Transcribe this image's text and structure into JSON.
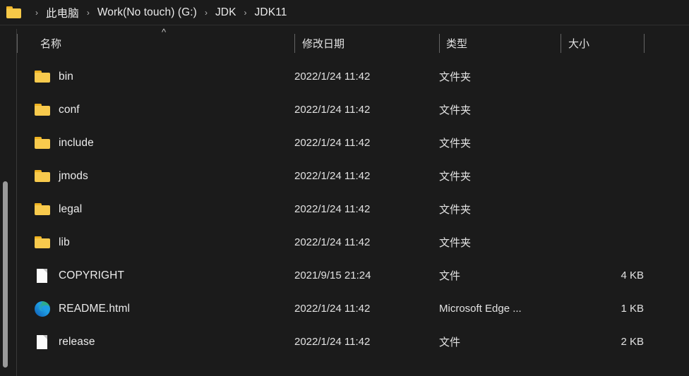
{
  "window": {
    "background_color": "#1b1b1b",
    "text_color": "#e6e6e6"
  },
  "breadcrumb": {
    "leading_icon": "folder-icon",
    "separator": "›",
    "crumbs": [
      {
        "label": "此电脑"
      },
      {
        "label": "Work(No touch) (G:)"
      },
      {
        "label": "JDK"
      },
      {
        "label": "JDK11"
      }
    ]
  },
  "columns": {
    "sort_indicator_icon": "chevron-up-icon",
    "items": [
      {
        "key": "name",
        "label": "名称"
      },
      {
        "key": "date",
        "label": "修改日期"
      },
      {
        "key": "type",
        "label": "类型"
      },
      {
        "key": "size",
        "label": "大小"
      }
    ]
  },
  "files": {
    "rows": [
      {
        "icon": "folder-icon",
        "name": "bin",
        "date": "2022/1/24 11:42",
        "type": "文件夹",
        "size": ""
      },
      {
        "icon": "folder-icon",
        "name": "conf",
        "date": "2022/1/24 11:42",
        "type": "文件夹",
        "size": ""
      },
      {
        "icon": "folder-icon",
        "name": "include",
        "date": "2022/1/24 11:42",
        "type": "文件夹",
        "size": ""
      },
      {
        "icon": "folder-icon",
        "name": "jmods",
        "date": "2022/1/24 11:42",
        "type": "文件夹",
        "size": ""
      },
      {
        "icon": "folder-icon",
        "name": "legal",
        "date": "2022/1/24 11:42",
        "type": "文件夹",
        "size": ""
      },
      {
        "icon": "folder-icon",
        "name": "lib",
        "date": "2022/1/24 11:42",
        "type": "文件夹",
        "size": ""
      },
      {
        "icon": "document-icon",
        "name": "COPYRIGHT",
        "date": "2021/9/15 21:24",
        "type": "文件",
        "size": "4 KB"
      },
      {
        "icon": "edge-icon",
        "name": "README.html",
        "date": "2022/1/24 11:42",
        "type": "Microsoft Edge ...",
        "size": "1 KB"
      },
      {
        "icon": "document-icon",
        "name": "release",
        "date": "2022/1/24 11:42",
        "type": "文件",
        "size": "2 KB"
      }
    ]
  },
  "scrollbar": {
    "orientation": "vertical",
    "thumb_color": "#9a9a9a"
  },
  "colors": {
    "folder_yellow": "#f8ca4d",
    "folder_tab": "#eeb221",
    "document_white": "#fbfbfb",
    "edge_blue": "#0f59b2",
    "edge_teal": "#1e9de3",
    "edge_green": "#38b45a",
    "divider": "#646464"
  }
}
